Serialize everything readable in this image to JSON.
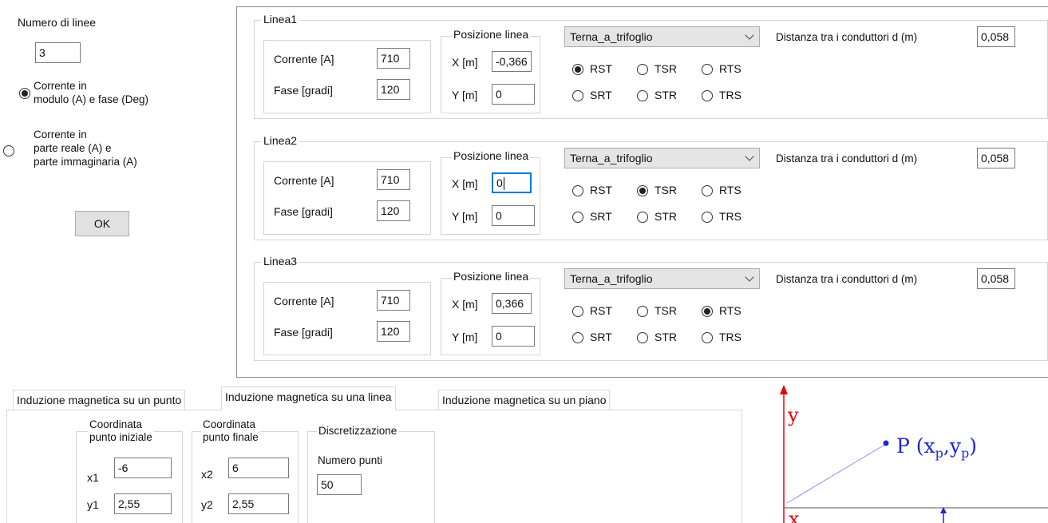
{
  "left": {
    "num_lines_label": "Numero di linee",
    "num_lines_value": "3",
    "radio_mod_fase_line1": "Corrente in",
    "radio_mod_fase_line2": "modulo (A) e fase (Deg)",
    "radio_re_im_line1": "Corrente in",
    "radio_re_im_line2": "parte reale (A) e",
    "radio_re_im_line3": "parte immaginaria (A)",
    "ok_label": "OK"
  },
  "common": {
    "corrente_label": "Corrente [A]",
    "fase_label": "Fase [gradi]",
    "posizione_label": "Posizione linea",
    "x_label": "X [m]",
    "y_label": "Y [m]",
    "distanza_label": "Distanza tra i conduttori d (m)",
    "rst": "RST",
    "tsr": "TSR",
    "rts": "RTS",
    "srt": "SRT",
    "str": "STR",
    "trs": "TRS"
  },
  "lines": [
    {
      "title": "Linea1",
      "corrente": "710",
      "fase": "120",
      "x": "-0,366",
      "y": "0",
      "tipo": "Terna_a_trifoglio",
      "distanza": "0,058",
      "selected": "RST"
    },
    {
      "title": "Linea2",
      "corrente": "710",
      "fase": "120",
      "x": "0",
      "y": "0",
      "tipo": "Terna_a_trifoglio",
      "distanza": "0,058",
      "selected": "TSR"
    },
    {
      "title": "Linea3",
      "corrente": "710",
      "fase": "120",
      "x": "0,366",
      "y": "0",
      "tipo": "Terna_a_trifoglio",
      "distanza": "0,058",
      "selected": "RTS"
    }
  ],
  "tabs": [
    "Induzione magnetica su un punto",
    "Induzione magnetica su una linea",
    "Induzione magnetica su un piano"
  ],
  "active_tab": 1,
  "bottom": {
    "start_title_1": "Coordinata",
    "start_title_2": "punto iniziale",
    "end_title_1": "Coordinata",
    "end_title_2": "punto finale",
    "disc_title": "Discretizzazione",
    "x1_label": "x1",
    "x1": "-6",
    "y1_label": "y1",
    "y1": "2,55",
    "x2_label": "x2",
    "x2": "6",
    "y2_label": "y2",
    "y2": "2,55",
    "num_punti_label": "Numero punti",
    "num_punti": "50"
  },
  "diagram": {
    "y_axis": "y",
    "x_axis": "x",
    "point_label": "P (x",
    "point_sub_x": "p",
    "point_comma": ",y",
    "point_sub_y": "p",
    "point_close": ")",
    "axis_color": "#e8000b",
    "point_color": "#1d26d9"
  }
}
